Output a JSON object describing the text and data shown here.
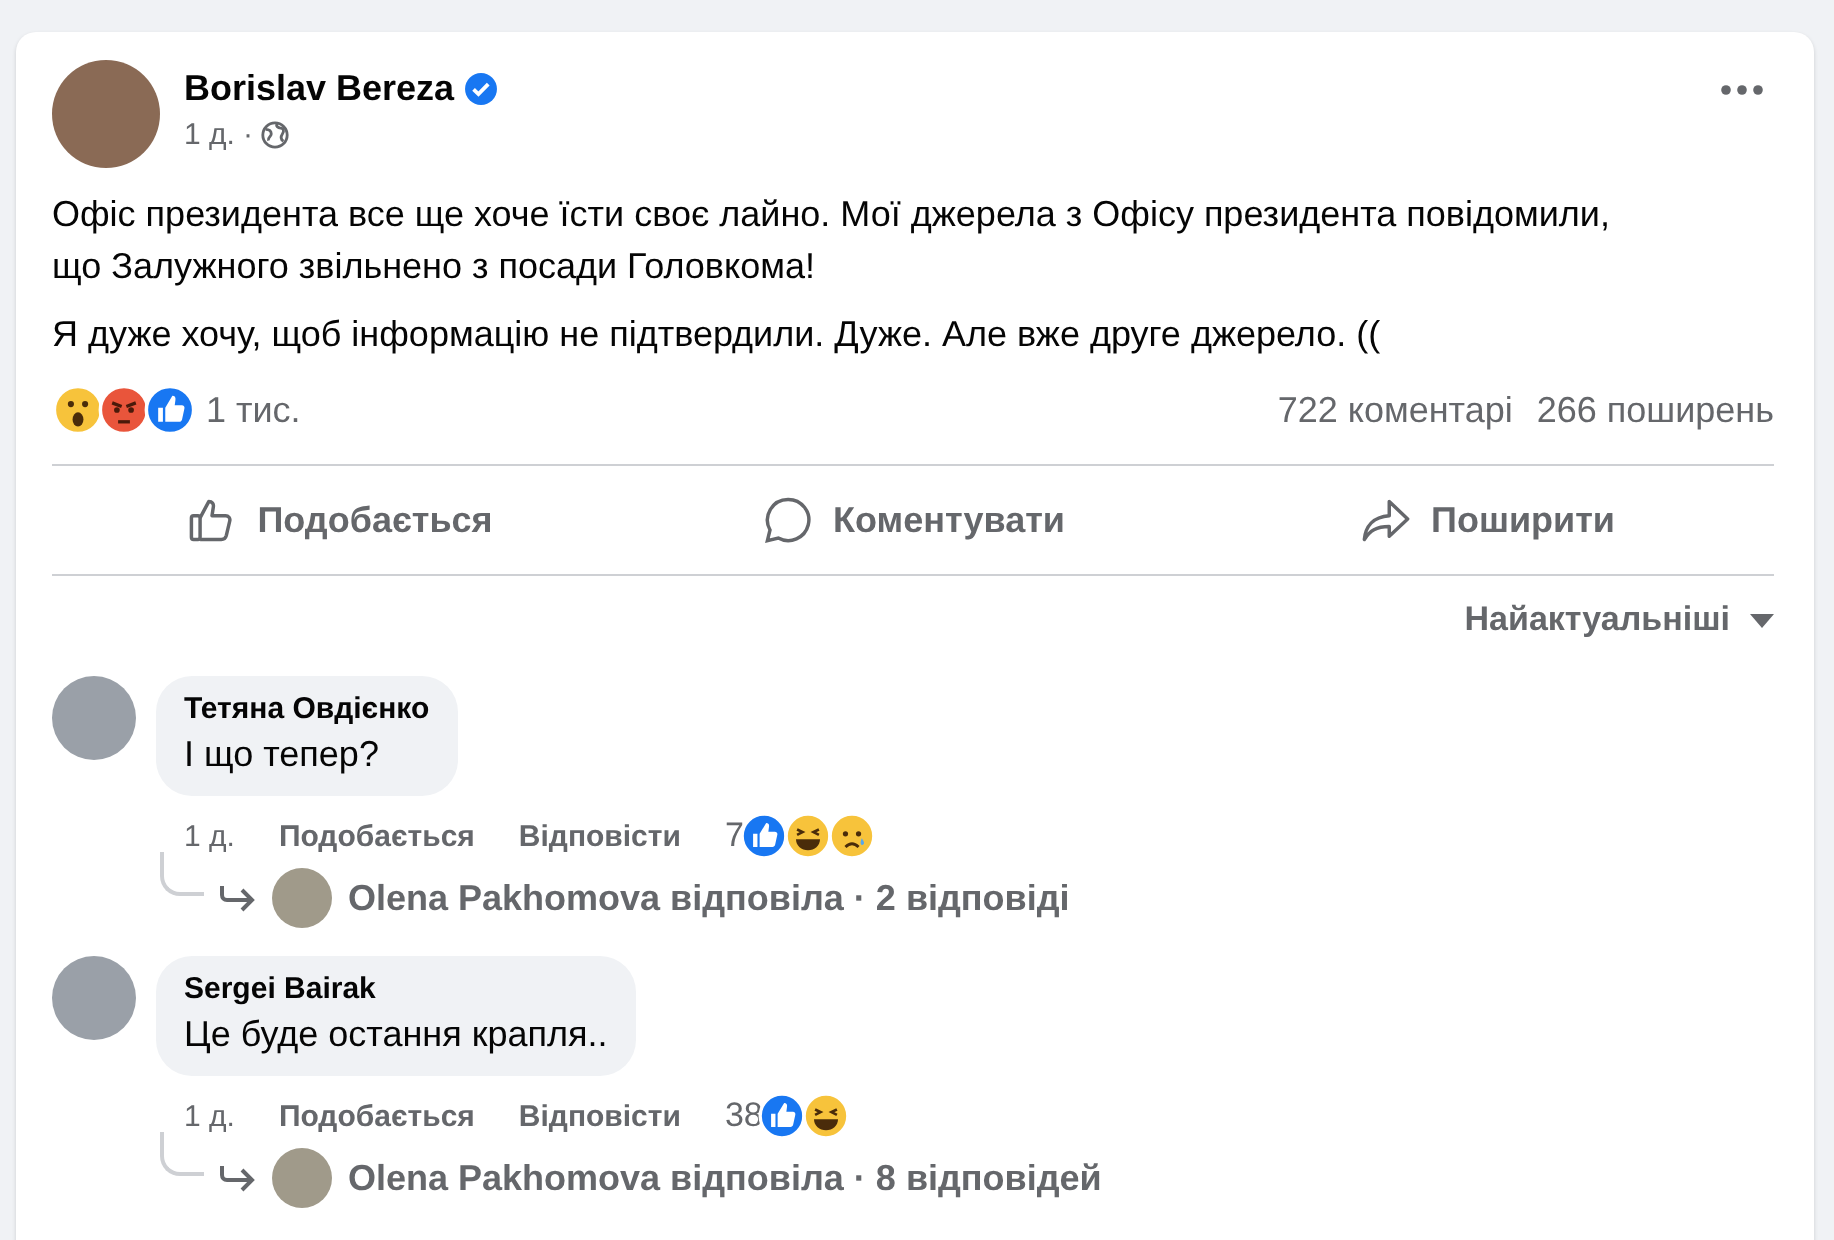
{
  "post": {
    "author": "Borislav Bereza",
    "verified": true,
    "time": "1 д.",
    "separator": "·",
    "paragraphs": [
      "Офіс президента все ще хоче їсти своє лайно. Мої джерела з Офісу президента повідомили, що Залужного звільнено з посади Головкома!",
      "Я дуже хочу, щоб інформацію не підтвердили. Дуже. Але вже друге джерело. (("
    ],
    "reactions": [
      {
        "kind": "wow"
      },
      {
        "kind": "angry"
      },
      {
        "kind": "like"
      }
    ],
    "reaction_count": "1 тис.",
    "comments_count": "722 коментарі",
    "shares_count": "266 поширень"
  },
  "actions": [
    {
      "kind": "like",
      "label": "Подобається"
    },
    {
      "kind": "comment",
      "label": "Коментувати"
    },
    {
      "kind": "share",
      "label": "Поширити"
    }
  ],
  "sort": "Найактуальніші",
  "comments": [
    {
      "author": "Тетяна Овдієнко",
      "text": "І що тепер?",
      "time": "1 д.",
      "like": "Подобається",
      "reply": "Відповісти",
      "reaction_count": "7",
      "reactions": [
        {
          "kind": "like"
        },
        {
          "kind": "haha"
        },
        {
          "kind": "sad"
        }
      ],
      "replies": "Olena Pakhomova відповіла · 2 відповіді"
    },
    {
      "author": "Sergei Bairak",
      "text": "Це буде остання крапля..",
      "time": "1 д.",
      "like": "Подобається",
      "reply": "Відповісти",
      "reaction_count": "38",
      "reactions": [
        {
          "kind": "like"
        },
        {
          "kind": "haha"
        }
      ],
      "replies": "Olena Pakhomova відповіла · 8 відповідей"
    }
  ]
}
